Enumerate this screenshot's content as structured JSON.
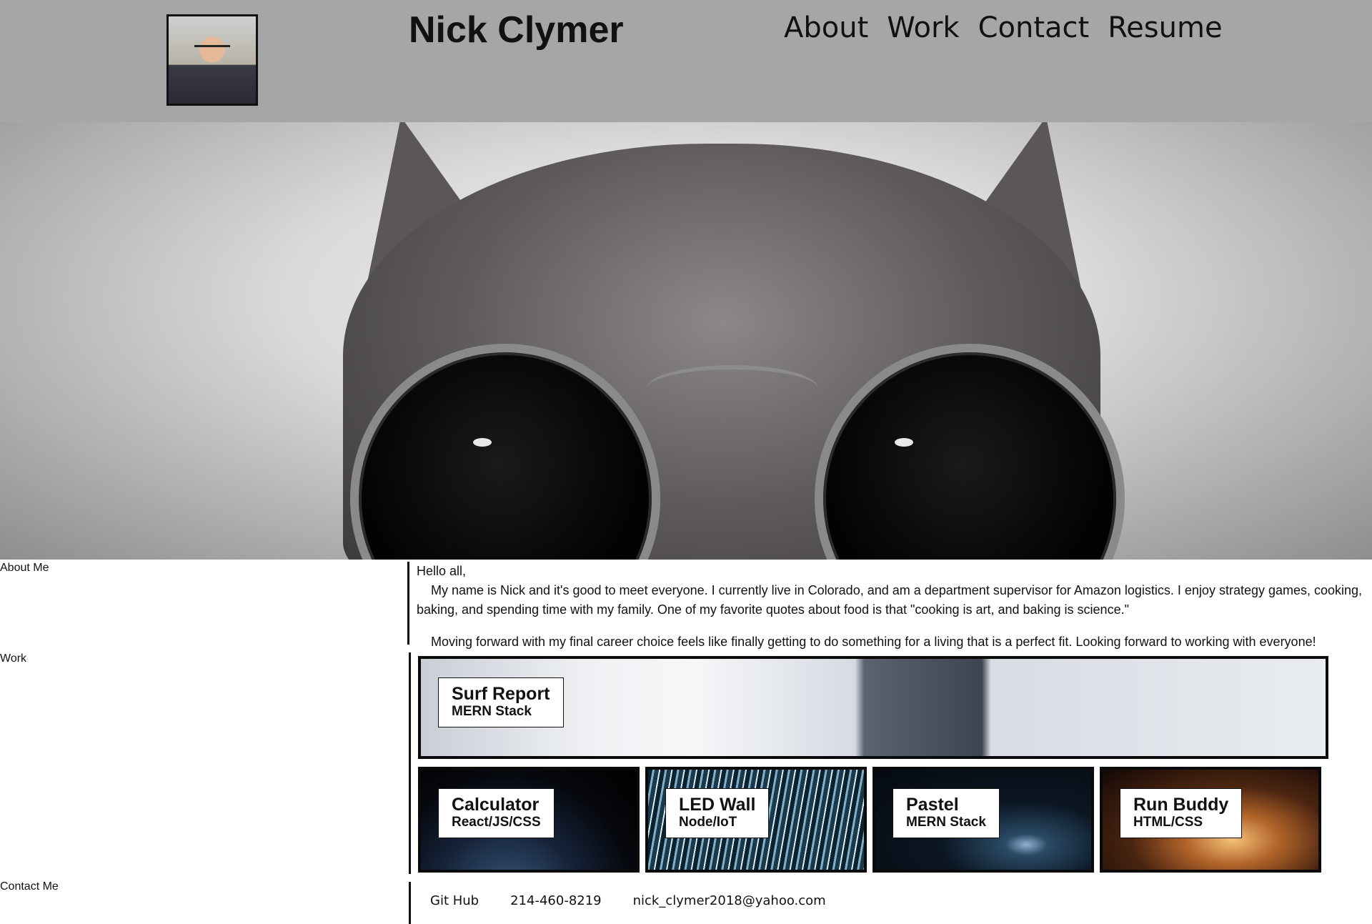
{
  "header": {
    "title": "Nick Clymer",
    "nav": [
      "About",
      "Work",
      "Contact",
      "Resume"
    ]
  },
  "sections": {
    "about_label": "About Me",
    "work_label": "Work",
    "contact_label": "Contact Me"
  },
  "about": {
    "greeting": "Hello all,",
    "paragraph1": "My name is Nick and it's good to meet everyone. I currently live in Colorado, and am a department supervisor for Amazon logistics. I enjoy strategy games, cooking, baking, and spending time with my family. One of my favorite quotes about food is that \"cooking is art, and baking is science.\"",
    "paragraph2": "Moving forward with my final career choice feels like finally getting to do something for a living that is a perfect fit. Looking forward to working with everyone!"
  },
  "projects": [
    {
      "name": "Surf Report",
      "stack": "MERN Stack"
    },
    {
      "name": "Calculator",
      "stack": "React/JS/CSS"
    },
    {
      "name": "LED Wall",
      "stack": "Node/IoT"
    },
    {
      "name": "Pastel",
      "stack": "MERN Stack"
    },
    {
      "name": "Run Buddy",
      "stack": "HTML/CSS"
    }
  ],
  "contact": {
    "github": "Git Hub",
    "phone": "214-460-8219",
    "email": "nick_clymer2018@yahoo.com"
  },
  "colors": {
    "header_bg": "#a6a6a6",
    "text": "#111111",
    "page_bg": "#ffffff"
  }
}
